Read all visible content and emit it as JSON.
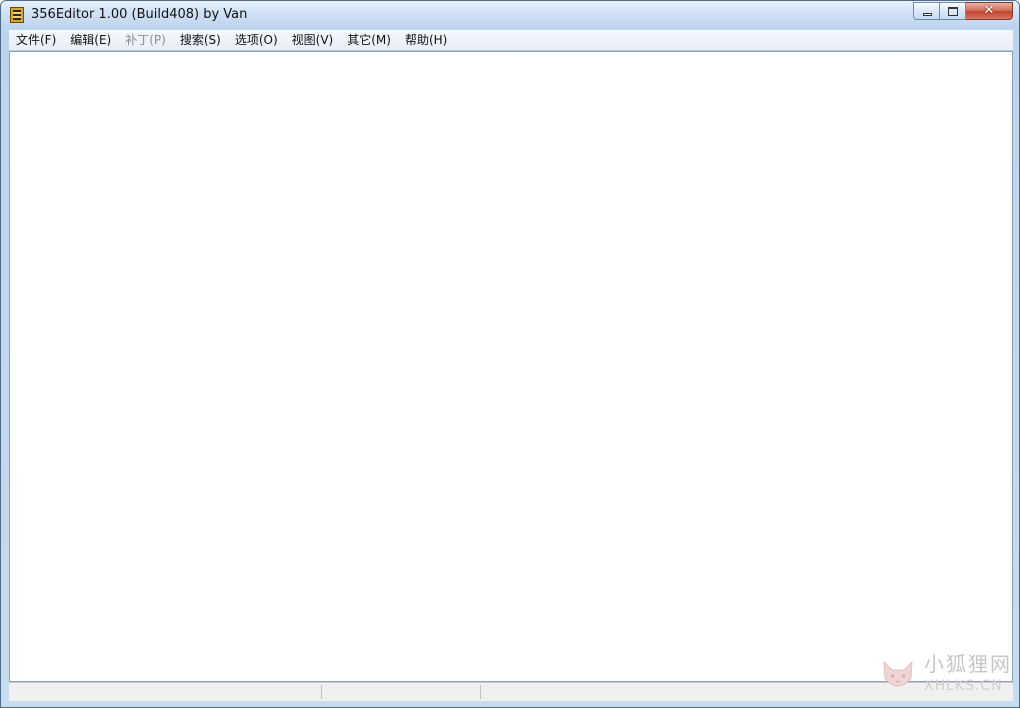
{
  "window": {
    "title": "356Editor 1.00 (Build408) by Van",
    "close_glyph": "✕"
  },
  "menubar": {
    "items": [
      {
        "label": "文件(F)",
        "enabled": true
      },
      {
        "label": "编辑(E)",
        "enabled": true
      },
      {
        "label": "补丁(P)",
        "enabled": false
      },
      {
        "label": "搜索(S)",
        "enabled": true
      },
      {
        "label": "选项(O)",
        "enabled": true
      },
      {
        "label": "视图(V)",
        "enabled": true
      },
      {
        "label": "其它(M)",
        "enabled": true
      },
      {
        "label": "帮助(H)",
        "enabled": true
      }
    ]
  },
  "statusbar": {
    "panes": [
      "",
      "",
      ""
    ]
  },
  "watermark": {
    "text_cn": "小狐狸网",
    "text_en": "XHLKS.CN",
    "icon": "fox-logo-icon"
  },
  "colors": {
    "title_gradient_top": "#e6f0fb",
    "close_button": "#c2432d",
    "menu_disabled": "#8c8c8c",
    "watermark": "#c7c7c7"
  }
}
